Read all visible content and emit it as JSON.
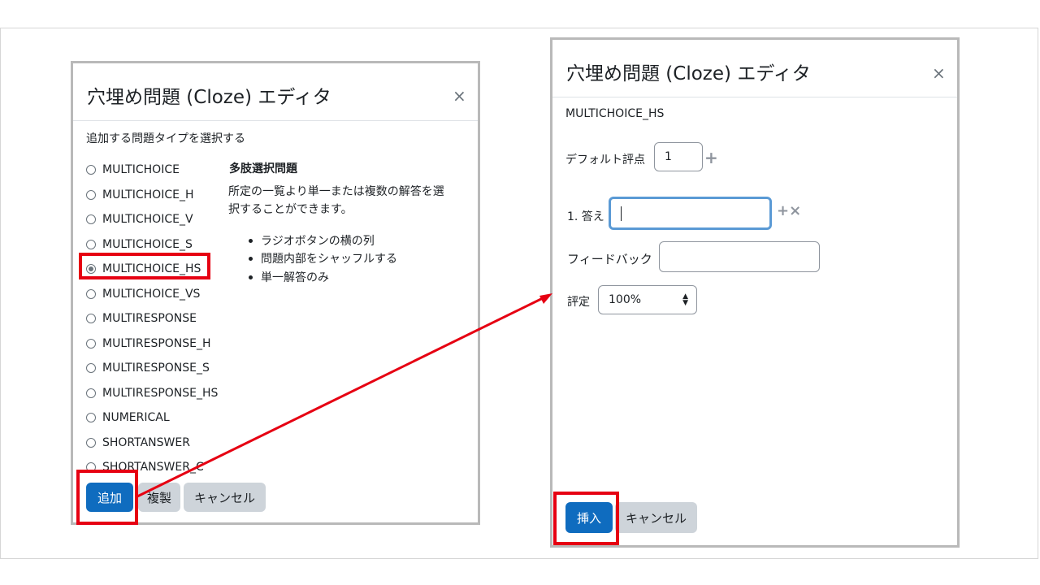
{
  "left_dialog": {
    "title": "穴埋め問題 (Cloze) エディタ",
    "close": "×",
    "prompt": "追加する問題タイプを選択する",
    "types": [
      {
        "label": "MULTICHOICE",
        "checked": false
      },
      {
        "label": "MULTICHOICE_H",
        "checked": false
      },
      {
        "label": "MULTICHOICE_V",
        "checked": false
      },
      {
        "label": "MULTICHOICE_S",
        "checked": false
      },
      {
        "label": "MULTICHOICE_HS",
        "checked": true
      },
      {
        "label": "MULTICHOICE_VS",
        "checked": false
      },
      {
        "label": "MULTIRESPONSE",
        "checked": false
      },
      {
        "label": "MULTIRESPONSE_H",
        "checked": false
      },
      {
        "label": "MULTIRESPONSE_S",
        "checked": false
      },
      {
        "label": "MULTIRESPONSE_HS",
        "checked": false
      },
      {
        "label": "NUMERICAL",
        "checked": false
      },
      {
        "label": "SHORTANSWER",
        "checked": false
      },
      {
        "label": "SHORTANSWER_C",
        "checked": false
      }
    ],
    "desc_title": "多肢選択問題",
    "desc_line1": "所定の一覧より単一または複数の解答を選",
    "desc_line2": "択することができます。",
    "bullets": [
      "ラジオボタンの横の列",
      "問題内部をシャッフルする",
      "単一解答のみ"
    ],
    "buttons": {
      "add": "追加",
      "duplicate": "複製",
      "cancel": "キャンセル"
    }
  },
  "right_dialog": {
    "title": "穴埋め問題 (Cloze) エディタ",
    "close": "×",
    "type_name": "MULTICHOICE_HS",
    "default_grade_label": "デフォルト評点",
    "default_grade_value": "1",
    "answer_label": "1. 答え",
    "answer_value": "",
    "feedback_label": "フィードバック",
    "feedback_value": "",
    "grade_label": "評定",
    "grade_value": "100%",
    "add_icon": "+",
    "add_remove_icon": "+×",
    "buttons": {
      "insert": "挿入",
      "cancel": "キャンセル"
    }
  },
  "annotations": {
    "highlight_color": "#e60012",
    "arrow_color": "#e60012"
  }
}
